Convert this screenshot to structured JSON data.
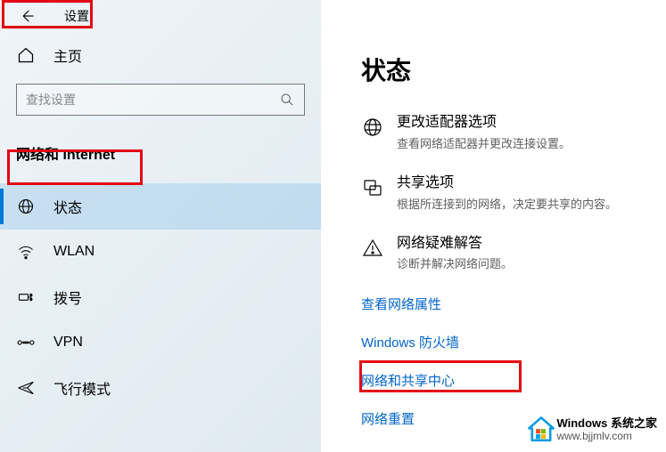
{
  "header": {
    "title": "设置"
  },
  "home": {
    "label": "主页"
  },
  "search": {
    "placeholder": "查找设置"
  },
  "section": {
    "title_prefix": "网络和",
    "title_suffix": " Internet"
  },
  "nav": [
    {
      "label": "状态",
      "active": true
    },
    {
      "label": "WLAN",
      "active": false
    },
    {
      "label": "拨号",
      "active": false
    },
    {
      "label": "VPN",
      "active": false
    },
    {
      "label": "飞行模式",
      "active": false
    }
  ],
  "content": {
    "title": "状态",
    "options": [
      {
        "title": "更改适配器选项",
        "sub": "查看网络适配器并更改连接设置。"
      },
      {
        "title": "共享选项",
        "sub": "根据所连接到的网络，决定要共享的内容。"
      },
      {
        "title": "网络疑难解答",
        "sub": "诊断并解决网络问题。"
      }
    ],
    "links": [
      "查看网络属性",
      "Windows 防火墙",
      "网络和共享中心",
      "网络重置"
    ]
  },
  "watermark": {
    "brand": "Windows 系统之家",
    "url": "www.bjjmlv.com"
  }
}
